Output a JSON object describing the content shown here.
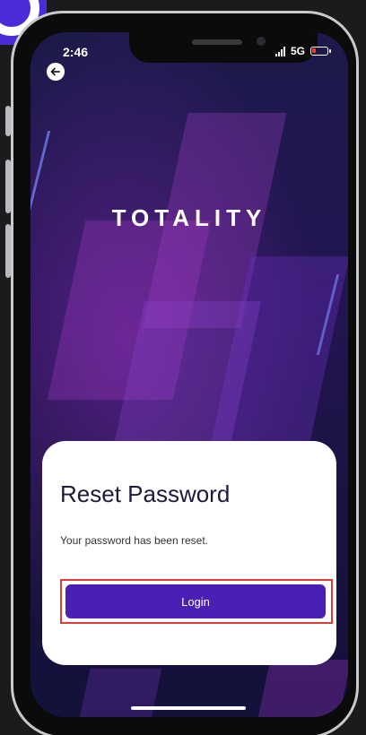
{
  "status_bar": {
    "time": "2:46",
    "network": "5G",
    "battery_color": "#ff3b30"
  },
  "header": {
    "back_icon": "arrow-left-icon"
  },
  "brand": {
    "logo_text": "TOTALITY"
  },
  "card": {
    "title": "Reset Password",
    "message": "Your password has been reset.",
    "login_label": "Login"
  },
  "colors": {
    "accent": "#4a20b4",
    "highlight": "#e03a3a",
    "badge": "#4b2ad8"
  }
}
